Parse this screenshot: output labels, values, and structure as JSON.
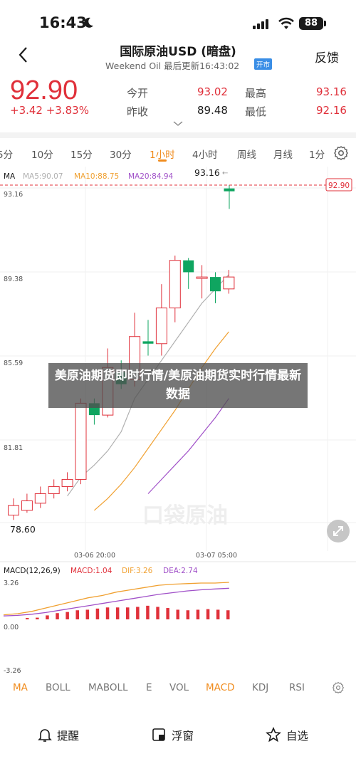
{
  "status_bar": {
    "time": "16:43",
    "battery": "88"
  },
  "header": {
    "back_icon": "back-icon",
    "title": "国际原油USD (暗盘)",
    "subtitle": "Weekend Oil 最后更新16:43:02",
    "badge": "开市",
    "feedback": "反馈"
  },
  "quote": {
    "price": "92.90",
    "change": "+3.42 +3.83%",
    "open_label": "今开",
    "open_value": "93.02",
    "high_label": "最高",
    "high_value": "93.16",
    "prev_label": "昨收",
    "prev_value": "89.48",
    "low_label": "最低",
    "low_value": "92.16"
  },
  "tabs": [
    "5分",
    "10分",
    "15分",
    "30分",
    "1小时",
    "4小时",
    "周线",
    "月线",
    "1分"
  ],
  "active_tab": "1小时",
  "main_chart": {
    "ma_title": "MA",
    "ma5": "MA5:90.07",
    "ma10": "MA10:88.75",
    "ma20": "MA20:84.94",
    "y_labels": [
      "93.16",
      "89.38",
      "85.59",
      "81.81",
      "78.60"
    ],
    "high_marker": "93.16",
    "last_price_tag": "92.90",
    "x_labels": [
      "03-06 20:00",
      "03-07 05:00"
    ],
    "watermark": "口袋原油",
    "colors": {
      "up": "#e0303a",
      "down": "#0fa560",
      "ma5": "#b0b0b0",
      "ma10": "#f0a030",
      "ma20": "#a050c8"
    }
  },
  "macd_chart": {
    "title": "MACD(12,26,9)",
    "macd": "MACD:1.04",
    "dif": "DIF:3.26",
    "dea": "DEA:2.74",
    "y_labels": [
      "3.26",
      "0.00",
      "-3.26"
    ]
  },
  "overlay": {
    "text": "美原油期货即时行情/美原油期货实时行情最新数据"
  },
  "indicators": [
    "MA",
    "BOLL",
    "MABOLL",
    "E",
    "VOL",
    "MACD",
    "KDJ",
    "RSI"
  ],
  "bottom_bar": {
    "alert": "提醒",
    "float": "浮窗",
    "watchlist": "自选"
  },
  "chart_data": [
    {
      "type": "candlestick",
      "title": "",
      "x_labels": [
        "03-06 20:00",
        "03-07 05:00"
      ],
      "ylim": [
        78.6,
        93.16
      ],
      "candles": [
        {
          "o": 79.3,
          "c": 79.7,
          "h": 80.0,
          "l": 79.1
        },
        {
          "o": 79.5,
          "c": 79.9,
          "h": 80.2,
          "l": 79.4
        },
        {
          "o": 79.8,
          "c": 80.2,
          "h": 80.5,
          "l": 79.6
        },
        {
          "o": 80.2,
          "c": 80.5,
          "h": 80.8,
          "l": 80.0
        },
        {
          "o": 80.5,
          "c": 80.8,
          "h": 81.1,
          "l": 80.3
        },
        {
          "o": 80.8,
          "c": 84.0,
          "h": 84.2,
          "l": 80.6
        },
        {
          "o": 84.0,
          "c": 83.5,
          "h": 84.2,
          "l": 83.1
        },
        {
          "o": 83.5,
          "c": 85.5,
          "h": 86.3,
          "l": 83.4
        },
        {
          "o": 85.3,
          "c": 84.8,
          "h": 85.8,
          "l": 84.6
        },
        {
          "o": 85.0,
          "c": 86.8,
          "h": 87.8,
          "l": 84.7
        },
        {
          "o": 86.6,
          "c": 86.5,
          "h": 87.5,
          "l": 86.0
        },
        {
          "o": 86.5,
          "c": 88.0,
          "h": 89.0,
          "l": 86.0
        },
        {
          "o": 88.0,
          "c": 90.0,
          "h": 90.2,
          "l": 87.4
        },
        {
          "o": 90.0,
          "c": 89.5,
          "h": 90.1,
          "l": 88.8
        },
        {
          "o": 89.3,
          "c": 89.3,
          "h": 89.8,
          "l": 88.4
        },
        {
          "o": 89.3,
          "c": 88.7,
          "h": 89.5,
          "l": 88.2
        },
        {
          "o": 88.8,
          "c": 89.3,
          "h": 89.6,
          "l": 88.6
        },
        {
          "o": 93.02,
          "c": 92.9,
          "h": 93.16,
          "l": 92.16
        }
      ],
      "ma5": [
        null,
        null,
        null,
        null,
        80.1,
        80.9,
        81.4,
        82.0,
        82.8,
        84.2,
        85.0,
        85.8,
        86.6,
        87.4,
        88.2,
        88.8,
        89.4,
        null
      ],
      "ma10": [
        null,
        null,
        null,
        null,
        null,
        null,
        79.5,
        80.0,
        80.6,
        81.3,
        82.1,
        82.9,
        83.7,
        84.6,
        85.5,
        86.3,
        87.0,
        null
      ],
      "ma20": [
        null,
        null,
        null,
        null,
        null,
        null,
        null,
        null,
        null,
        null,
        80.2,
        80.8,
        81.4,
        82.0,
        82.7,
        83.4,
        84.2,
        null
      ]
    },
    {
      "type": "bar",
      "title": "MACD(12,26,9)",
      "ylim": [
        -3.26,
        3.26
      ],
      "values": [
        0.12,
        0.15,
        0.35,
        0.55,
        0.65,
        0.8,
        0.85,
        0.95,
        1.05,
        1.05,
        1.05,
        1.1,
        1.2,
        1.1,
        1.0,
        0.85,
        0.8,
        0.85,
        0.9,
        0.85,
        0.8
      ],
      "dif": [
        0.4,
        0.5,
        0.7,
        1.0,
        1.3,
        1.6,
        1.9,
        2.1,
        2.4,
        2.6,
        2.8,
        3.0,
        3.1,
        3.15,
        3.2,
        3.2,
        3.26
      ],
      "dea": [
        0.3,
        0.35,
        0.45,
        0.6,
        0.8,
        1.0,
        1.2,
        1.4,
        1.6,
        1.8,
        2.0,
        2.2,
        2.35,
        2.5,
        2.6,
        2.68,
        2.74
      ]
    }
  ]
}
